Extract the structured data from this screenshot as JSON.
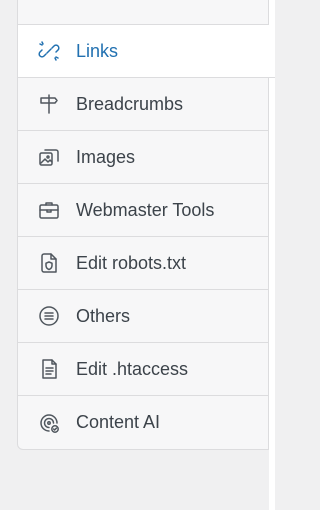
{
  "menu": {
    "items": [
      {
        "label": "Links",
        "icon": "link-broken-icon",
        "active": true
      },
      {
        "label": "Breadcrumbs",
        "icon": "signpost-icon",
        "active": false
      },
      {
        "label": "Images",
        "icon": "images-icon",
        "active": false
      },
      {
        "label": "Webmaster Tools",
        "icon": "toolbox-icon",
        "active": false
      },
      {
        "label": "Edit robots.txt",
        "icon": "folder-shield-icon",
        "active": false
      },
      {
        "label": "Others",
        "icon": "list-circle-icon",
        "active": false
      },
      {
        "label": "Edit .htaccess",
        "icon": "file-text-icon",
        "active": false
      },
      {
        "label": "Content AI",
        "icon": "content-ai-icon",
        "active": false
      }
    ]
  },
  "colors": {
    "accent": "#2271b1",
    "text": "#3c434a",
    "border": "#dcdcde",
    "background": "#f0f0f1"
  }
}
